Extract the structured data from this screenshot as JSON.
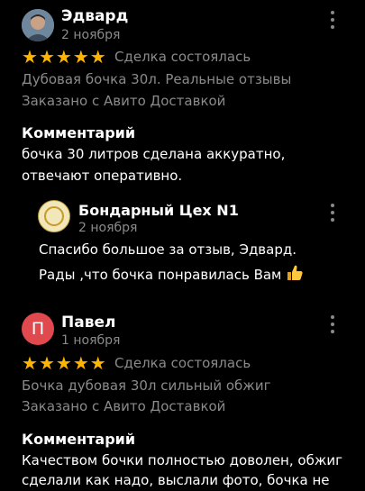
{
  "reviews": [
    {
      "author": "Эдвард",
      "date": "2 ноября",
      "rating": 5,
      "deal_status": "Сделка состоялась",
      "item": "Дубовая бочка 30л. Реальные отзывы",
      "delivery": "Заказано с Авито Доставкой",
      "comment_heading": "Комментарий",
      "comment_lines": [
        "бочка 30 литров сделана аккуратно,",
        "отвечают оперативно."
      ],
      "reply": {
        "author": "Бондарный Цех N1",
        "date": "2 ноября",
        "lines": [
          "Спасибо большое за отзыв, Эдвард.",
          "Рады ,что бочка понравилась Вам"
        ],
        "emoji": "thumbs-up"
      }
    },
    {
      "author": "Павел",
      "avatar_letter": "П",
      "date": "1 ноября",
      "rating": 5,
      "deal_status": "Сделка состоялась",
      "item": "Бочка дубовая 30л сильный обжиг",
      "delivery": "Заказано с Авито Доставкой",
      "comment_heading": "Комментарий",
      "comment_lines": [
        "Качеством бочки полностью доволен, обжиг",
        "сделали как надо, выслали фото, бочка не"
      ]
    }
  ],
  "icons": {
    "star": "star-icon",
    "more": "more-vertical-icon",
    "thumb": "thumbs-up-emoji"
  },
  "colors": {
    "background": "#000000",
    "star": "#ffb400",
    "muted": "#8a8a8a",
    "avatar_letter_bg": "#e04a4f"
  }
}
